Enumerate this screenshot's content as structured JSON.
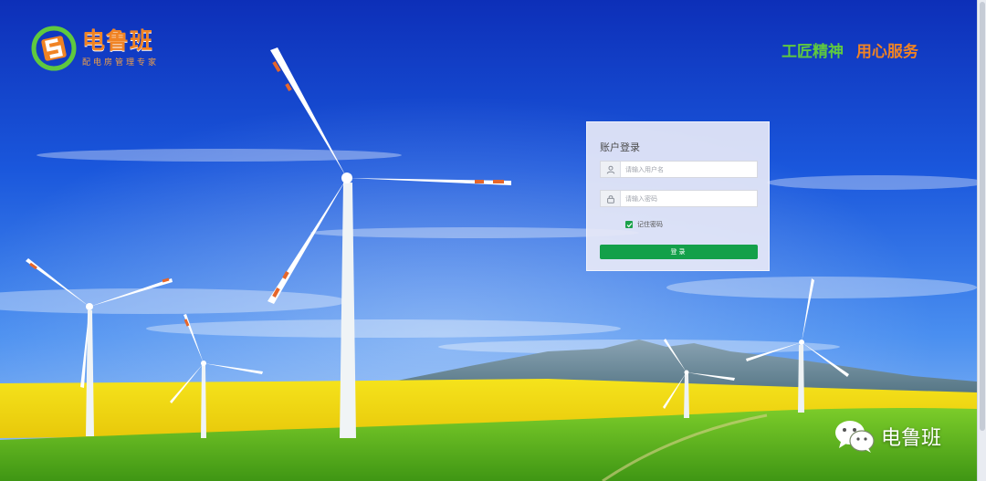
{
  "brand": {
    "name": "电鲁班",
    "subtitle": "配电房管理专家",
    "logo_icon": "brand-logo-icon"
  },
  "slogan": {
    "part1": "工匠精神",
    "part2": "用心服务"
  },
  "login": {
    "title": "账户登录",
    "username": {
      "placeholder": "请输入用户名",
      "value": "",
      "icon": "user-icon"
    },
    "password": {
      "placeholder": "请输入密码",
      "value": "",
      "icon": "lock-icon"
    },
    "remember": {
      "label": "记住密码",
      "checked": true
    },
    "submit_label": "登录"
  },
  "watermark": {
    "text": "电鲁班",
    "icon": "wechat-icon"
  },
  "colors": {
    "accent_green": "#13a04a",
    "brand_orange": "#f08324",
    "slogan_green": "#5fc93f"
  }
}
